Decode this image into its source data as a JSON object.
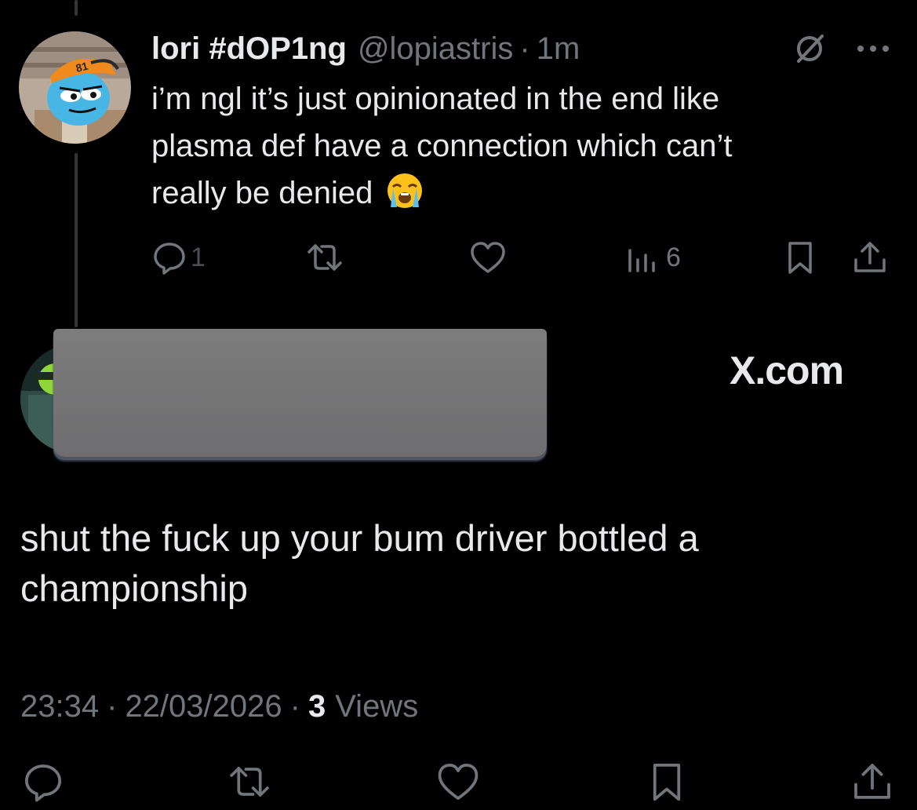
{
  "tweet": {
    "display_name": "lori #dOP1ng",
    "handle": "@lopiastris",
    "separator": "·",
    "time_ago": "1m",
    "text_lines": [
      "i’m ngl it’s just opinionated in the end like",
      "plasma def have a connection which can’t",
      "really be denied"
    ],
    "emoji": "loudly-crying-face",
    "reply_count": "1",
    "views_count": "6",
    "avatar_badge": "81"
  },
  "watermark": {
    "site": "X.com"
  },
  "reply": {
    "text_lines": [
      "shut the fuck up your bum driver bottled a",
      "championship"
    ],
    "time": "23:34",
    "separator": "·",
    "date": "22/03/2026",
    "views_count": "3",
    "views_label": "Views"
  },
  "icons": {
    "top_right": [
      "grok-slash-icon",
      "more-icon"
    ],
    "tweet_actions": [
      "reply-icon",
      "retweet-icon",
      "like-icon",
      "views-icon",
      "bookmark-icon",
      "share-icon"
    ],
    "reply_actions": [
      "reply-icon",
      "retweet-icon",
      "like-icon",
      "bookmark-icon",
      "share-icon"
    ]
  },
  "colors": {
    "background": "#000000",
    "text_primary": "#e7e9ea",
    "text_secondary": "#71767b",
    "thread_line": "#333639",
    "redaction": "#757575"
  }
}
